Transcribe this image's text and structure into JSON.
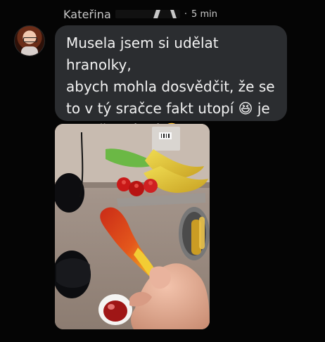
{
  "message": {
    "sender_name": "Kateřina",
    "separator": "·",
    "timestamp": "5 min",
    "text": "Musela jsem si udělat hranolky,\nabych mohla dosvědčit, že se\nto v tý sračce fakt utopí 😆 je\nto mňamózní 🤤"
  },
  "attachment": {
    "type": "photo"
  },
  "colors": {
    "background": "#050505",
    "bubble": "#2b2d30",
    "text": "#f2f2f2",
    "meta": "#c9c9c9"
  }
}
